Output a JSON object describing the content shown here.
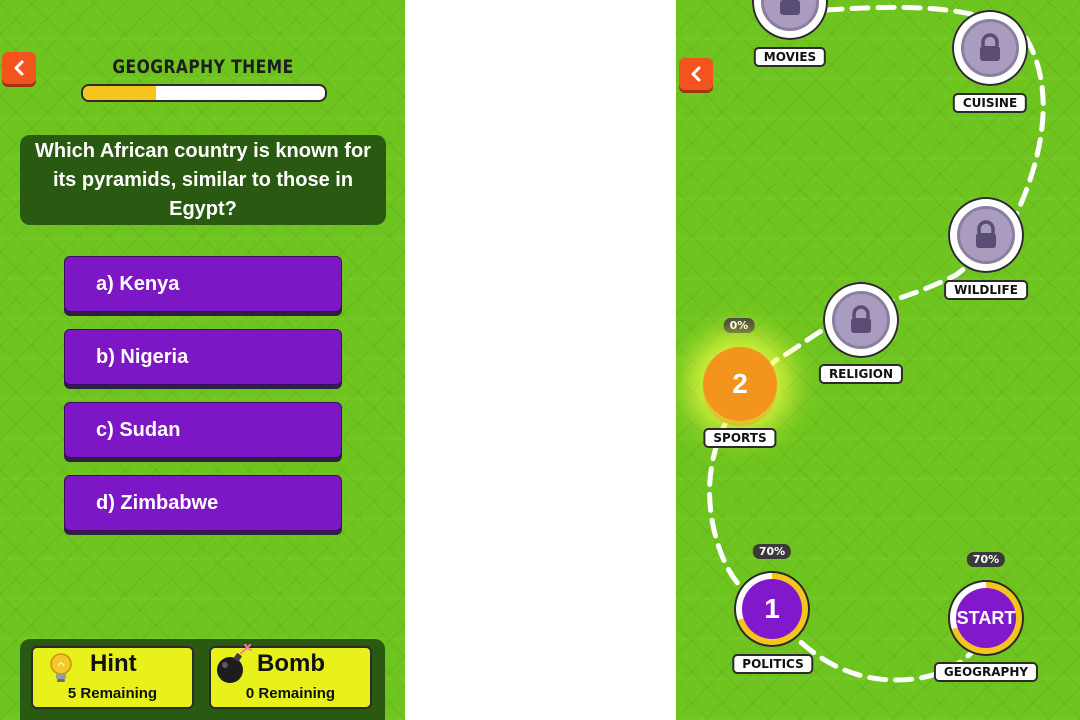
{
  "quiz": {
    "theme_title": "GEOGRAPHY THEME",
    "progress_fraction": 0.3,
    "question": "Which African country is known for its pyramids, similar to those in Egypt?",
    "answers": [
      {
        "label": "a) Kenya"
      },
      {
        "label": "b) Nigeria"
      },
      {
        "label": "c) Sudan"
      },
      {
        "label": "d) Zimbabwe"
      }
    ],
    "powerups": {
      "hint": {
        "title": "Hint",
        "count": "5 Remaining",
        "icon": "lightbulb-icon"
      },
      "bomb": {
        "title": "Bomb",
        "count": "0 Remaining",
        "icon": "bomb-icon"
      }
    },
    "back_icon": "chevron-left-icon"
  },
  "map": {
    "back_icon": "chevron-left-icon",
    "nodes": {
      "movies": {
        "label": "MOVIES",
        "state": "locked"
      },
      "cuisine": {
        "label": "CUISINE",
        "state": "locked"
      },
      "wildlife": {
        "label": "WILDLIFE",
        "state": "locked"
      },
      "religion": {
        "label": "RELIGION",
        "state": "locked"
      },
      "sports": {
        "label": "SPORTS",
        "number": "2",
        "percent": "0%",
        "state": "current"
      },
      "politics": {
        "label": "POLITICS",
        "number": "1",
        "percent": "70%",
        "state": "done"
      },
      "geography": {
        "label": "GEOGRAPHY",
        "number": "START",
        "percent": "70%",
        "state": "done"
      }
    }
  },
  "colors": {
    "background_green": "#6fc51f",
    "answer_purple": "#7d17c5",
    "question_box": "#2a5a12",
    "powerup_yellow": "#e8f21a",
    "current_orange": "#f3951d",
    "back_orange": "#f3531d"
  }
}
